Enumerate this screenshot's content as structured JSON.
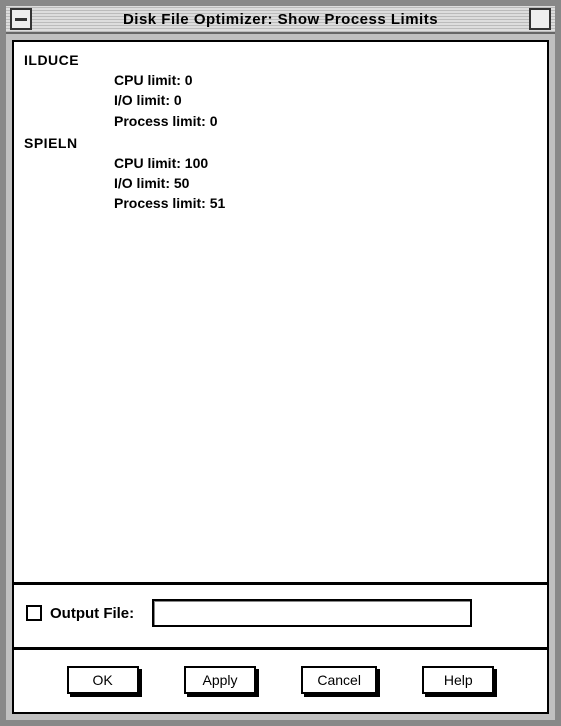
{
  "window": {
    "title": "Disk File Optimizer: Show Process Limits"
  },
  "processes": [
    {
      "name": "ILDUCE",
      "cpu_limit_label": "CPU limit:",
      "cpu_limit_value": "0",
      "io_limit_label": "I/O limit:",
      "io_limit_value": "0",
      "process_limit_label": "Process limit:",
      "process_limit_value": "0"
    },
    {
      "name": "SPIELN",
      "cpu_limit_label": "CPU limit:",
      "cpu_limit_value": "100",
      "io_limit_label": "I/O limit:",
      "io_limit_value": "50",
      "process_limit_label": "Process limit:",
      "process_limit_value": "51"
    }
  ],
  "output": {
    "checkbox_checked": false,
    "label": "Output File:",
    "value": ""
  },
  "buttons": {
    "ok": "OK",
    "apply": "Apply",
    "cancel": "Cancel",
    "help": "Help"
  }
}
